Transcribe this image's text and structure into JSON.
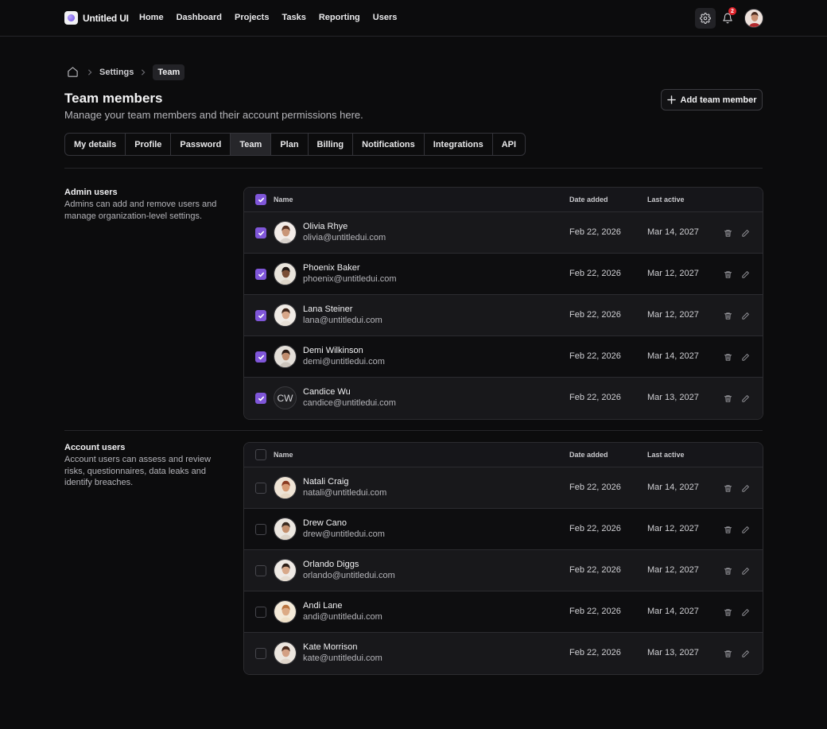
{
  "brand": {
    "name": "Untitled UI"
  },
  "nav": [
    "Home",
    "Dashboard",
    "Projects",
    "Tasks",
    "Reporting",
    "Users"
  ],
  "header": {
    "notification_count": "2"
  },
  "breadcrumb": {
    "items": [
      "Settings",
      "Team"
    ]
  },
  "page": {
    "title": "Team members",
    "subtitle": "Manage your team members and their account permissions here.",
    "add_button": "Add team member"
  },
  "tabs": [
    "My details",
    "Profile",
    "Password",
    "Team",
    "Plan",
    "Billing",
    "Notifications",
    "Integrations",
    "API"
  ],
  "active_tab": "Team",
  "sections": [
    {
      "title": "Admin users",
      "description": "Admins can add and remove users and manage organization-level settings.",
      "columns": {
        "name": "Name",
        "date_added": "Date added",
        "last_active": "Last active"
      },
      "header_checked": true,
      "rows": [
        {
          "name": "Olivia Rhye",
          "email": "olivia@untitledui.com",
          "date_added": "Feb 22, 2026",
          "last_active": "Mar 14, 2027",
          "checked": true,
          "avatar": "photo"
        },
        {
          "name": "Phoenix Baker",
          "email": "phoenix@untitledui.com",
          "date_added": "Feb 22, 2026",
          "last_active": "Mar 12, 2027",
          "checked": true,
          "avatar": "photo"
        },
        {
          "name": "Lana Steiner",
          "email": "lana@untitledui.com",
          "date_added": "Feb 22, 2026",
          "last_active": "Mar 12, 2027",
          "checked": true,
          "avatar": "photo"
        },
        {
          "name": "Demi Wilkinson",
          "email": "demi@untitledui.com",
          "date_added": "Feb 22, 2026",
          "last_active": "Mar 14, 2027",
          "checked": true,
          "avatar": "photo"
        },
        {
          "name": "Candice Wu",
          "email": "candice@untitledui.com",
          "date_added": "Feb 22, 2026",
          "last_active": "Mar 13, 2027",
          "checked": true,
          "avatar": "CW"
        }
      ]
    },
    {
      "title": "Account users",
      "description": "Account users can assess and review risks, questionnaires, data leaks and identify breaches.",
      "columns": {
        "name": "Name",
        "date_added": "Date added",
        "last_active": "Last active"
      },
      "header_checked": false,
      "rows": [
        {
          "name": "Natali Craig",
          "email": "natali@untitledui.com",
          "date_added": "Feb 22, 2026",
          "last_active": "Mar 14, 2027",
          "checked": false,
          "avatar": "photo"
        },
        {
          "name": "Drew Cano",
          "email": "drew@untitledui.com",
          "date_added": "Feb 22, 2026",
          "last_active": "Mar 12, 2027",
          "checked": false,
          "avatar": "photo"
        },
        {
          "name": "Orlando Diggs",
          "email": "orlando@untitledui.com",
          "date_added": "Feb 22, 2026",
          "last_active": "Mar 12, 2027",
          "checked": false,
          "avatar": "photo"
        },
        {
          "name": "Andi Lane",
          "email": "andi@untitledui.com",
          "date_added": "Feb 22, 2026",
          "last_active": "Mar 14, 2027",
          "checked": false,
          "avatar": "photo"
        },
        {
          "name": "Kate Morrison",
          "email": "kate@untitledui.com",
          "date_added": "Feb 22, 2026",
          "last_active": "Mar 13, 2027",
          "checked": false,
          "avatar": "photo"
        }
      ]
    }
  ],
  "colors": {
    "accent": "#7f56d9",
    "background": "#0c0c0d",
    "row_alt": "#18181b",
    "badge": "#e0242c"
  },
  "icons": [
    "home-icon",
    "chevron-right-icon",
    "plus-icon",
    "gear-icon",
    "bell-icon",
    "check-icon",
    "trash-icon",
    "pencil-icon"
  ]
}
